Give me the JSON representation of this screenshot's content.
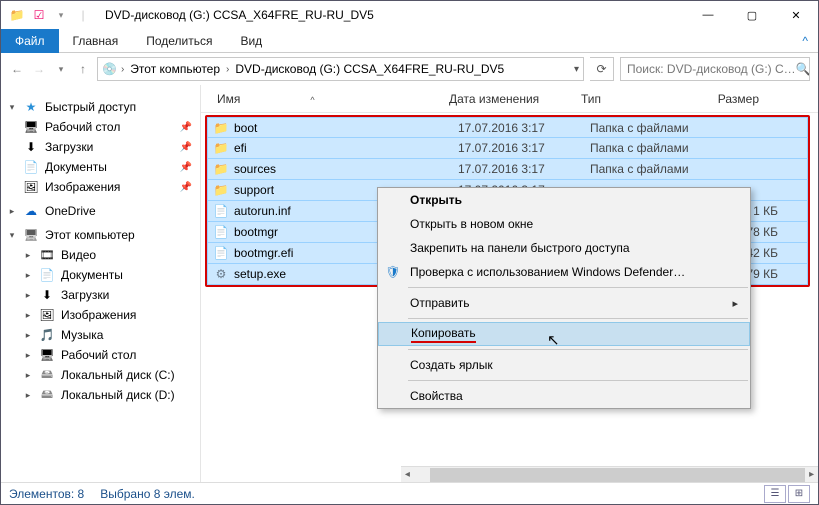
{
  "title": "DVD-дисковод (G:) CCSA_X64FRE_RU-RU_DV5",
  "ribbon": {
    "file": "Файл",
    "tabs": [
      "Главная",
      "Поделиться",
      "Вид"
    ]
  },
  "breadcrumb": {
    "root": "Этот компьютер",
    "leaf": "DVD-дисковод (G:) CCSA_X64FRE_RU-RU_DV5"
  },
  "search_placeholder": "Поиск: DVD-дисковод (G:) C…",
  "sidebar": {
    "quick": {
      "label": "Быстрый доступ",
      "items": [
        "Рабочий стол",
        "Загрузки",
        "Документы",
        "Изображения"
      ]
    },
    "onedrive": "OneDrive",
    "pc": {
      "label": "Этот компьютер",
      "items": [
        "Видео",
        "Документы",
        "Загрузки",
        "Изображения",
        "Музыка",
        "Рабочий стол",
        "Локальный диск (C:)",
        "Локальный диск (D:)"
      ]
    }
  },
  "columns": {
    "name": "Имя",
    "date": "Дата изменения",
    "type": "Тип",
    "size": "Размер"
  },
  "rows": [
    {
      "icon": "folder",
      "name": "boot",
      "date": "17.07.2016 3:17",
      "type": "Папка с файлами",
      "size": ""
    },
    {
      "icon": "folder",
      "name": "efi",
      "date": "17.07.2016 3:17",
      "type": "Папка с файлами",
      "size": ""
    },
    {
      "icon": "folder",
      "name": "sources",
      "date": "17.07.2016 3:17",
      "type": "Папка с файлами",
      "size": ""
    },
    {
      "icon": "folder",
      "name": "support",
      "date": "17.07.2016 3:17",
      "type": "",
      "size": ""
    },
    {
      "icon": "file",
      "name": "autorun.inf",
      "date": "",
      "type": "",
      "size": "1 КБ"
    },
    {
      "icon": "file",
      "name": "bootmgr",
      "date": "",
      "type": "",
      "size": "378 КБ"
    },
    {
      "icon": "file",
      "name": "bootmgr.efi",
      "date": "",
      "type": "",
      "size": "1 142 КБ"
    },
    {
      "icon": "exe",
      "name": "setup.exe",
      "date": "",
      "type": "",
      "size": "79 КБ"
    }
  ],
  "context_menu": {
    "items": [
      {
        "label": "Открыть",
        "bold": true
      },
      {
        "label": "Открыть в новом окне"
      },
      {
        "label": "Закрепить на панели быстрого доступа"
      },
      {
        "label": "Проверка с использованием Windows Defender…",
        "icon": "shield"
      },
      {
        "sep": true
      },
      {
        "label": "Отправить",
        "submenu": true
      },
      {
        "sep": true
      },
      {
        "label": "Копировать",
        "highlight": true,
        "underline": true
      },
      {
        "sep": true
      },
      {
        "label": "Создать ярлык"
      },
      {
        "sep": true
      },
      {
        "label": "Свойства"
      }
    ]
  },
  "status": {
    "count": "Элементов: 8",
    "selected": "Выбрано 8 элем."
  }
}
